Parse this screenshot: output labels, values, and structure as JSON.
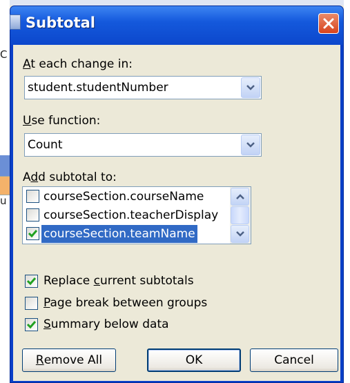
{
  "background": {
    "fragment_1": "C",
    "fragment_2": "u"
  },
  "dialog": {
    "title": "Subtotal",
    "at_each_change": {
      "label_mnemonic": "A",
      "label_rest": "t each change in:",
      "value": "student.studentNumber"
    },
    "use_function": {
      "label_mnemonic": "U",
      "label_rest": "se function:",
      "value": "Count"
    },
    "add_subtotal": {
      "label_pre": "A",
      "label_mnemonic": "d",
      "label_rest": "d subtotal to:",
      "items": [
        {
          "label": "courseSection.courseName",
          "checked": false,
          "selected": false
        },
        {
          "label": "courseSection.teacherDisplay",
          "checked": false,
          "selected": false
        },
        {
          "label": "courseSection.teamName",
          "checked": true,
          "selected": true
        }
      ]
    },
    "options": {
      "replace": {
        "pre": "Replace ",
        "mnemonic": "c",
        "rest": "urrent subtotals",
        "checked": true
      },
      "page_break": {
        "pre": "",
        "mnemonic": "P",
        "rest": "age break between groups",
        "checked": false
      },
      "summary": {
        "pre": "",
        "mnemonic": "S",
        "rest": "ummary below data",
        "checked": true
      }
    },
    "buttons": {
      "remove_all": {
        "mnemonic": "R",
        "rest": "emove All"
      },
      "ok": "OK",
      "cancel": "Cancel"
    }
  },
  "colors": {
    "titlebar": "#0c47cc",
    "selection": "#316ac5",
    "check": "#21a121",
    "close": "#d8431c"
  }
}
